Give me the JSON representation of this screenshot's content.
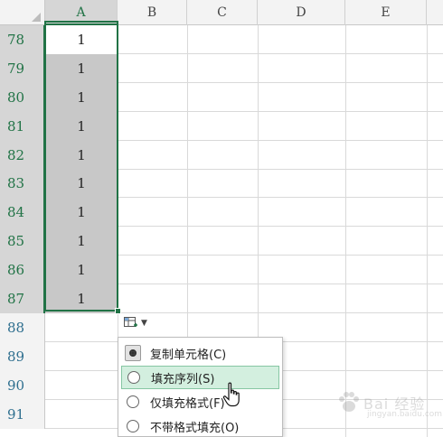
{
  "columns": [
    "A",
    "B",
    "C",
    "D",
    "E"
  ],
  "rows": [
    {
      "num": "78",
      "a": "1"
    },
    {
      "num": "79",
      "a": "1"
    },
    {
      "num": "80",
      "a": "1"
    },
    {
      "num": "81",
      "a": "1"
    },
    {
      "num": "82",
      "a": "1"
    },
    {
      "num": "83",
      "a": "1"
    },
    {
      "num": "84",
      "a": "1"
    },
    {
      "num": "85",
      "a": "1"
    },
    {
      "num": "86",
      "a": "1"
    },
    {
      "num": "87",
      "a": "1"
    },
    {
      "num": "88",
      "a": ""
    },
    {
      "num": "89",
      "a": ""
    },
    {
      "num": "90",
      "a": ""
    },
    {
      "num": "91",
      "a": ""
    }
  ],
  "autofill_menu": {
    "items": [
      {
        "label": "复制单元格(C)",
        "state": "selected"
      },
      {
        "label": "填充序列(S)",
        "state": "hover"
      },
      {
        "label": "仅填充格式(F)",
        "state": ""
      },
      {
        "label": "不带格式填充(O)",
        "state": ""
      }
    ]
  },
  "watermark": {
    "text": "Bai 经验",
    "url": "jingyan.baidu.com"
  },
  "colors": {
    "accent": "#217346",
    "selection_fill": "#c8c8c8",
    "hover_fill": "#d3efdf"
  }
}
